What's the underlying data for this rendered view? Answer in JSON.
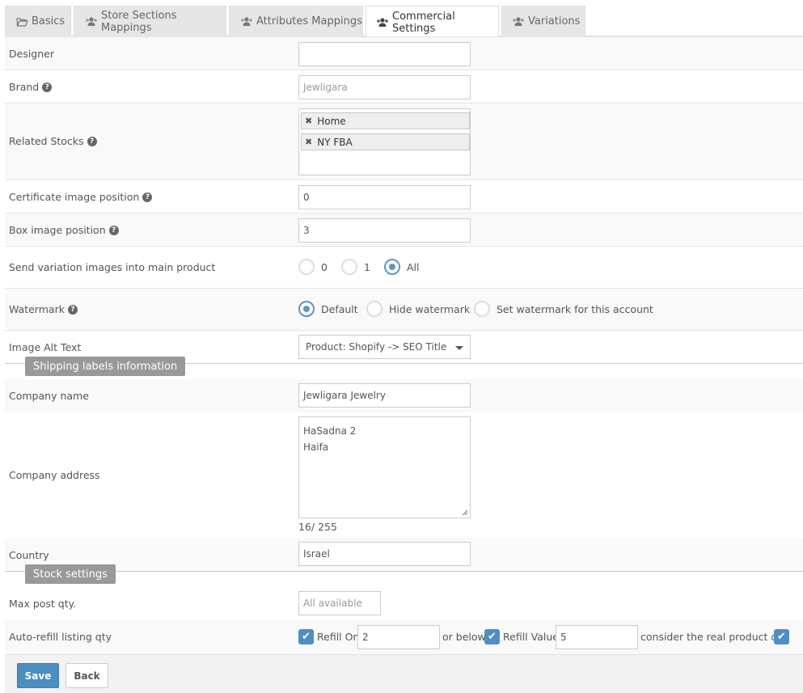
{
  "tabs": [
    {
      "label": "Basics",
      "icon": "folder-open-icon"
    },
    {
      "label": "Store Sections Mappings",
      "icon": "users-icon"
    },
    {
      "label": "Attributes Mappings",
      "icon": "users-icon"
    },
    {
      "label": "Commercial Settings",
      "icon": "users-icon",
      "active": true
    },
    {
      "label": "Variations",
      "icon": "users-icon"
    }
  ],
  "fields": {
    "designer": {
      "label": "Designer",
      "value": ""
    },
    "brand": {
      "label": "Brand",
      "placeholder": "Jewligara"
    },
    "related_stocks": {
      "label": "Related Stocks",
      "tags": [
        "Home",
        "NY FBA"
      ]
    },
    "certificate_position": {
      "label": "Certificate image position",
      "value": "0"
    },
    "box_position": {
      "label": "Box image position",
      "value": "3"
    },
    "send_variation": {
      "label": "Send variation images into main product",
      "options": [
        "0",
        "1",
        "All"
      ],
      "selected": "All"
    },
    "watermark": {
      "label": "Watermark",
      "options": [
        "Default",
        "Hide watermark",
        "Set watermark for this account"
      ],
      "selected": "Default"
    },
    "image_alt": {
      "label": "Image Alt Text",
      "value": "Product: Shopify -> SEO Title"
    }
  },
  "shipping": {
    "section_label": "Shipping labels information",
    "company_name": {
      "label": "Company name",
      "value": "Jewligara Jewelry"
    },
    "company_address": {
      "label": "Company address",
      "line1": "HaSadna 2",
      "line2": "Haifa",
      "counter": "16/ 255"
    },
    "country": {
      "label": "Country",
      "value": "Israel"
    }
  },
  "stock": {
    "section_label": "Stock settings",
    "max_post": {
      "label": "Max post qty.",
      "placeholder": "All available"
    },
    "auto_refill": {
      "label": "Auto-refill listing qty",
      "refill_on_label": "Refill On",
      "refill_on_value": "2",
      "or_below": "or below",
      "refill_value_label": "Refill Value",
      "refill_value": "5",
      "consider_label": "consider the real product qty"
    }
  },
  "buttons": {
    "save": "Save",
    "back": "Back"
  },
  "colors": {
    "accent": "#4a8ec2",
    "section_badge": "#999999"
  }
}
